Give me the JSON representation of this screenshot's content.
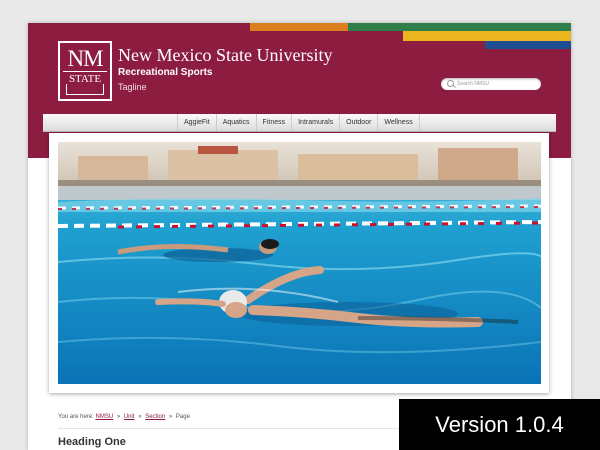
{
  "brand": {
    "logo_line1": "NM",
    "logo_line2": "STATE",
    "university": "New Mexico State University",
    "unit": "Recreational Sports",
    "tagline": "Tagline"
  },
  "colors": {
    "crimson": "#8c1d40",
    "orange": "#d97f20",
    "green": "#2e7f4a",
    "yellow": "#eab51e",
    "blue": "#1f4f92"
  },
  "search": {
    "placeholder": "Search NMSU",
    "icon": "search-icon"
  },
  "nav": {
    "items": [
      "AggieFit",
      "Aquatics",
      "Fitness",
      "Intramurals",
      "Outdoor",
      "Wellness"
    ]
  },
  "breadcrumb": {
    "prefix": "You are here:",
    "items": [
      "NMSU",
      "Unit",
      "Section"
    ],
    "current": "Page",
    "separator": "»"
  },
  "content": {
    "heading": "Heading One"
  },
  "badge": {
    "version": "Version 1.0.4"
  }
}
